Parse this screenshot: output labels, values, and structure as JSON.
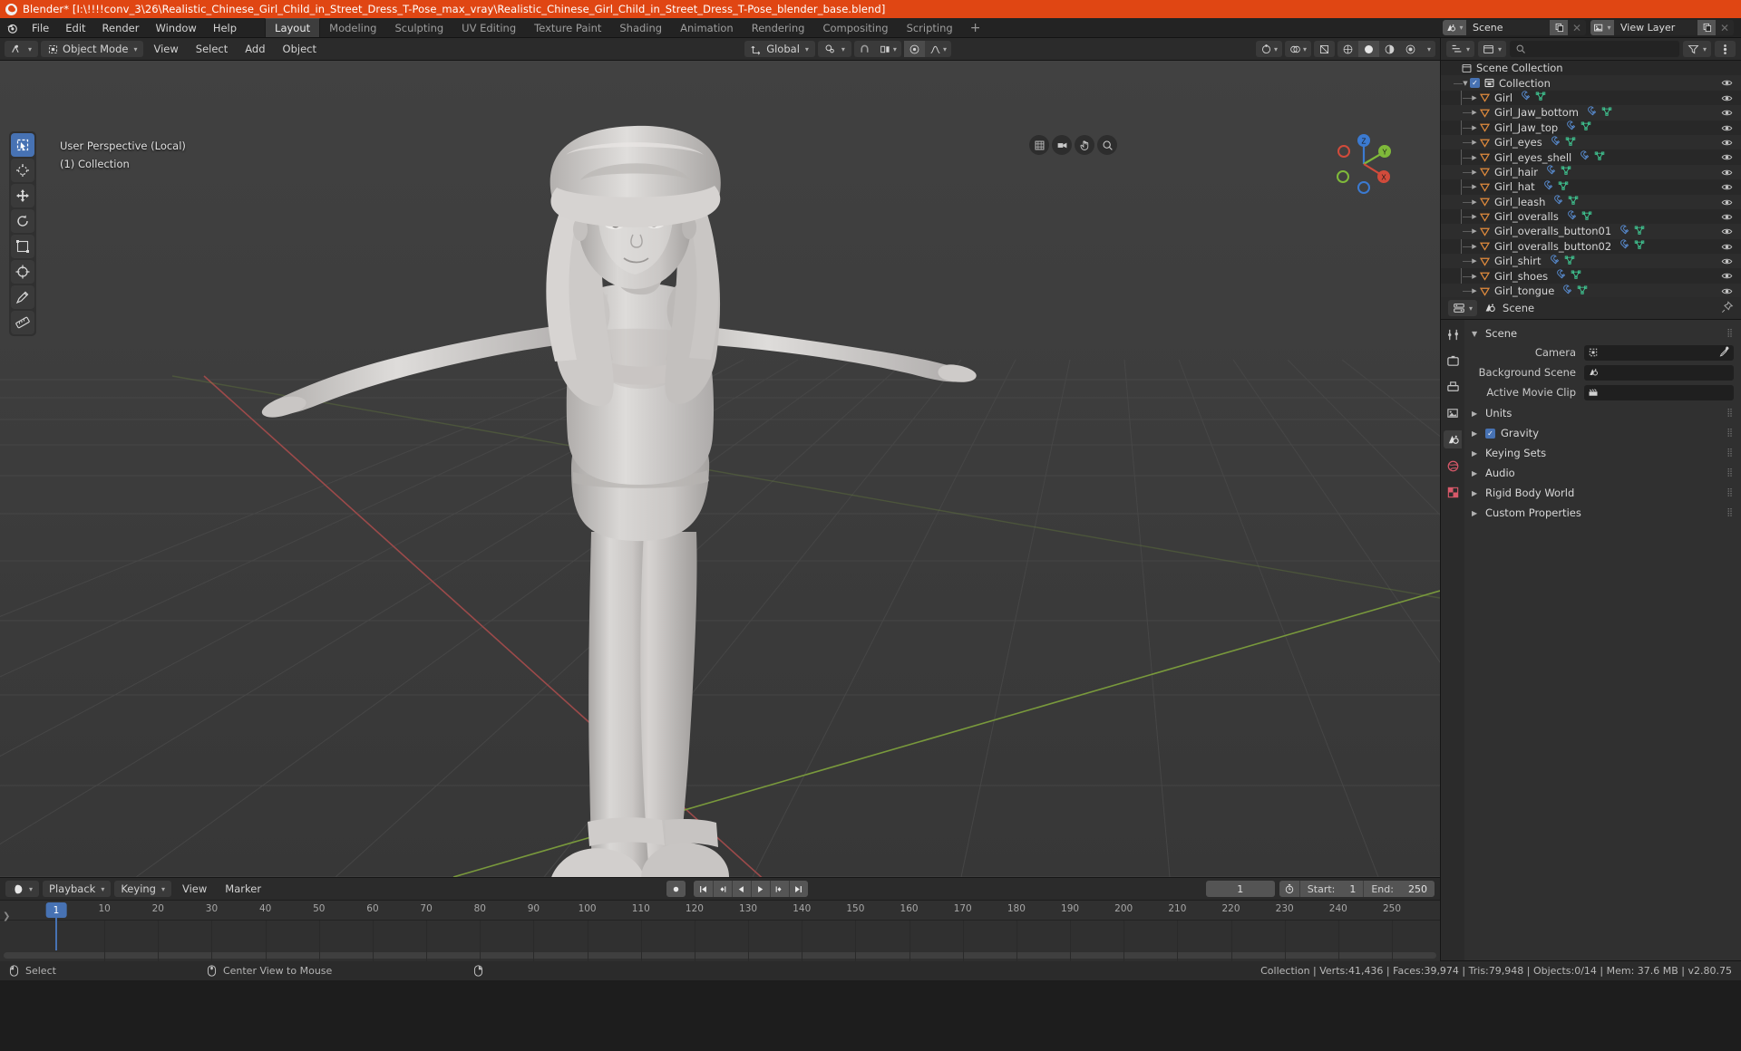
{
  "titlebar": {
    "text": "Blender* [I:\\!!!!conv_3\\26\\Realistic_Chinese_Girl_Child_in_Street_Dress_T-Pose_max_vray\\Realistic_Chinese_Girl_Child_in_Street_Dress_T-Pose_blender_base.blend]",
    "logo_icon": "blender-logo-icon"
  },
  "topbar": {
    "logo_icon": "blender-menu-icon",
    "menus": [
      "File",
      "Edit",
      "Render",
      "Window",
      "Help"
    ],
    "workspaces": [
      {
        "label": "Layout",
        "active": true
      },
      {
        "label": "Modeling",
        "active": false
      },
      {
        "label": "Sculpting",
        "active": false
      },
      {
        "label": "UV Editing",
        "active": false
      },
      {
        "label": "Texture Paint",
        "active": false
      },
      {
        "label": "Shading",
        "active": false
      },
      {
        "label": "Animation",
        "active": false
      },
      {
        "label": "Rendering",
        "active": false
      },
      {
        "label": "Compositing",
        "active": false
      },
      {
        "label": "Scripting",
        "active": false
      }
    ],
    "add_workspace_label": "+",
    "scene_name": "Scene",
    "view_layer_name": "View Layer"
  },
  "viewport_header": {
    "mode": "Object Mode",
    "menus": [
      "View",
      "Select",
      "Add",
      "Object"
    ],
    "transform_orientation": "Global",
    "editor_type_icon": "editor-type-3dview-icon",
    "pivot_icon": "pivot-point-icon",
    "snap_icon": "magnet-icon",
    "snap_target_icon": "snap-increment-icon",
    "proportional_icon": "proportional-edit-icon",
    "falloff_icon": "falloff-smooth-icon"
  },
  "viewport": {
    "overlay_line1": "User Perspective (Local)",
    "overlay_line2": "(1) Collection",
    "tools": [
      {
        "name": "select-box-tool",
        "active": true
      },
      {
        "name": "cursor-tool",
        "active": false
      },
      {
        "name": "move-tool",
        "active": false
      },
      {
        "name": "rotate-tool",
        "active": false
      },
      {
        "name": "scale-tool",
        "active": false
      },
      {
        "name": "transform-tool",
        "active": false
      },
      {
        "name": "annotate-tool",
        "active": false
      },
      {
        "name": "measure-tool",
        "active": false
      }
    ],
    "gizmo_axes": [
      "X",
      "Y",
      "Z"
    ],
    "nav_buttons": [
      "zoom-icon",
      "move-view-icon",
      "camera-view-icon",
      "toggle-ortho-icon"
    ],
    "shading_modes": [
      "wireframe",
      "solid",
      "material-preview",
      "rendered"
    ],
    "active_shading_mode": "solid",
    "colors": {
      "background_top": "#3f3f3f",
      "background_bottom": "#383838",
      "grid_line": "#4a4a4a",
      "axis_x": "#a33d3d",
      "axis_y": "#7aa03a",
      "model_light": "#d8d6d4",
      "model_mid": "#bdbab8",
      "model_shadow": "#9e9b99"
    }
  },
  "timeline": {
    "editor_icon": "timeline-editor-icon",
    "menus": [
      "Playback",
      "Keying",
      "View",
      "Marker"
    ],
    "playback_buttons": [
      "record-icon",
      "jump-start-icon",
      "prev-keyframe-icon",
      "play-reverse-icon",
      "play-icon",
      "next-keyframe-icon",
      "jump-end-icon"
    ],
    "current_frame": "1",
    "use_preview_range_icon": "stopwatch-icon",
    "start_label": "Start:",
    "start_value": "1",
    "end_label": "End:",
    "end_value": "250",
    "playhead_frame": "1",
    "ticks": [
      "10",
      "20",
      "30",
      "40",
      "50",
      "60",
      "70",
      "80",
      "90",
      "100",
      "110",
      "120",
      "130",
      "140",
      "150",
      "160",
      "170",
      "180",
      "190",
      "200",
      "210",
      "220",
      "230",
      "240",
      "250"
    ]
  },
  "outliner": {
    "header_icons": [
      "editor-type-outliner-icon",
      "display-mode-icon",
      "filter-icon",
      "search-icon"
    ],
    "search_placeholder": "",
    "rows": [
      {
        "label": "Scene Collection",
        "indent": 0,
        "icon": "scene-collection-icon",
        "expander": "",
        "checkbox": false,
        "datas": [],
        "eye": false
      },
      {
        "label": "Collection",
        "indent": 1,
        "icon": "collection-icon",
        "expander": "down",
        "checkbox": true,
        "datas": [],
        "eye": true
      },
      {
        "label": "Girl",
        "indent": 2,
        "icon": "mesh-object-icon",
        "expander": "right",
        "checkbox": false,
        "datas": [
          "modifier-icon",
          "mesh-data-icon"
        ],
        "eye": true
      },
      {
        "label": "Girl_Jaw_bottom",
        "indent": 2,
        "icon": "mesh-object-icon",
        "expander": "right",
        "checkbox": false,
        "datas": [
          "modifier-icon",
          "mesh-data-icon"
        ],
        "eye": true
      },
      {
        "label": "Girl_Jaw_top",
        "indent": 2,
        "icon": "mesh-object-icon",
        "expander": "right",
        "checkbox": false,
        "datas": [
          "modifier-icon",
          "mesh-data-icon"
        ],
        "eye": true
      },
      {
        "label": "Girl_eyes",
        "indent": 2,
        "icon": "mesh-object-icon",
        "expander": "right",
        "checkbox": false,
        "datas": [
          "modifier-icon",
          "mesh-data-icon"
        ],
        "eye": true
      },
      {
        "label": "Girl_eyes_shell",
        "indent": 2,
        "icon": "mesh-object-icon",
        "expander": "right",
        "checkbox": false,
        "datas": [
          "modifier-icon",
          "mesh-data-icon"
        ],
        "eye": true
      },
      {
        "label": "Girl_hair",
        "indent": 2,
        "icon": "mesh-object-icon",
        "expander": "right",
        "checkbox": false,
        "datas": [
          "modifier-icon",
          "mesh-data-icon"
        ],
        "eye": true
      },
      {
        "label": "Girl_hat",
        "indent": 2,
        "icon": "mesh-object-icon",
        "expander": "right",
        "checkbox": false,
        "datas": [
          "modifier-icon",
          "mesh-data-icon"
        ],
        "eye": true
      },
      {
        "label": "Girl_leash",
        "indent": 2,
        "icon": "mesh-object-icon",
        "expander": "right",
        "checkbox": false,
        "datas": [
          "modifier-icon",
          "mesh-data-icon"
        ],
        "eye": true
      },
      {
        "label": "Girl_overalls",
        "indent": 2,
        "icon": "mesh-object-icon",
        "expander": "right",
        "checkbox": false,
        "datas": [
          "modifier-icon",
          "mesh-data-icon"
        ],
        "eye": true
      },
      {
        "label": "Girl_overalls_button01",
        "indent": 2,
        "icon": "mesh-object-icon",
        "expander": "right",
        "checkbox": false,
        "datas": [
          "modifier-icon",
          "mesh-data-icon"
        ],
        "eye": true
      },
      {
        "label": "Girl_overalls_button02",
        "indent": 2,
        "icon": "mesh-object-icon",
        "expander": "right",
        "checkbox": false,
        "datas": [
          "modifier-icon",
          "mesh-data-icon"
        ],
        "eye": true
      },
      {
        "label": "Girl_shirt",
        "indent": 2,
        "icon": "mesh-object-icon",
        "expander": "right",
        "checkbox": false,
        "datas": [
          "modifier-icon",
          "mesh-data-icon"
        ],
        "eye": true
      },
      {
        "label": "Girl_shoes",
        "indent": 2,
        "icon": "mesh-object-icon",
        "expander": "right",
        "checkbox": false,
        "datas": [
          "modifier-icon",
          "mesh-data-icon"
        ],
        "eye": true
      },
      {
        "label": "Girl_tongue",
        "indent": 2,
        "icon": "mesh-object-icon",
        "expander": "right",
        "checkbox": false,
        "datas": [
          "modifier-icon",
          "mesh-data-icon"
        ],
        "eye": true
      }
    ]
  },
  "properties": {
    "breadcrumb_icon": "scene-properties-icon",
    "breadcrumb_label": "Scene",
    "pin_icon": "pin-icon",
    "tabs": [
      {
        "name": "tool-properties-tab",
        "active": false
      },
      {
        "name": "render-properties-tab",
        "active": false
      },
      {
        "name": "output-properties-tab",
        "active": false
      },
      {
        "name": "view-layer-properties-tab",
        "active": false
      },
      {
        "name": "scene-properties-tab",
        "active": true
      },
      {
        "name": "world-properties-tab",
        "active": false
      },
      {
        "name": "texture-properties-tab",
        "active": false
      }
    ],
    "panels": [
      {
        "label": "Scene",
        "open": true,
        "checkbox": null
      },
      {
        "label": "Units",
        "open": false,
        "checkbox": null
      },
      {
        "label": "Gravity",
        "open": false,
        "checkbox": true
      },
      {
        "label": "Keying Sets",
        "open": false,
        "checkbox": null
      },
      {
        "label": "Audio",
        "open": false,
        "checkbox": null
      },
      {
        "label": "Rigid Body World",
        "open": false,
        "checkbox": null
      },
      {
        "label": "Custom Properties",
        "open": false,
        "checkbox": null
      }
    ],
    "scene_fields": [
      {
        "label": "Camera",
        "value": "",
        "icon": "camera-data-icon",
        "has_eyedropper": true
      },
      {
        "label": "Background Scene",
        "value": "",
        "icon": "scene-data-icon",
        "has_eyedropper": false
      },
      {
        "label": "Active Movie Clip",
        "value": "",
        "icon": "movie-clip-icon",
        "has_eyedropper": false
      }
    ]
  },
  "statusbar": {
    "left_items": [
      {
        "icon": "mouse-left-icon",
        "label": "Select"
      },
      {
        "icon": "mouse-middle-icon",
        "label": "Center View to Mouse"
      },
      {
        "icon": "mouse-right-icon",
        "label": ""
      }
    ],
    "stats": "Collection | Verts:41,436 | Faces:39,974 | Tris:79,948 | Objects:0/14 | Mem: 37.6 MB | v2.80.75"
  }
}
